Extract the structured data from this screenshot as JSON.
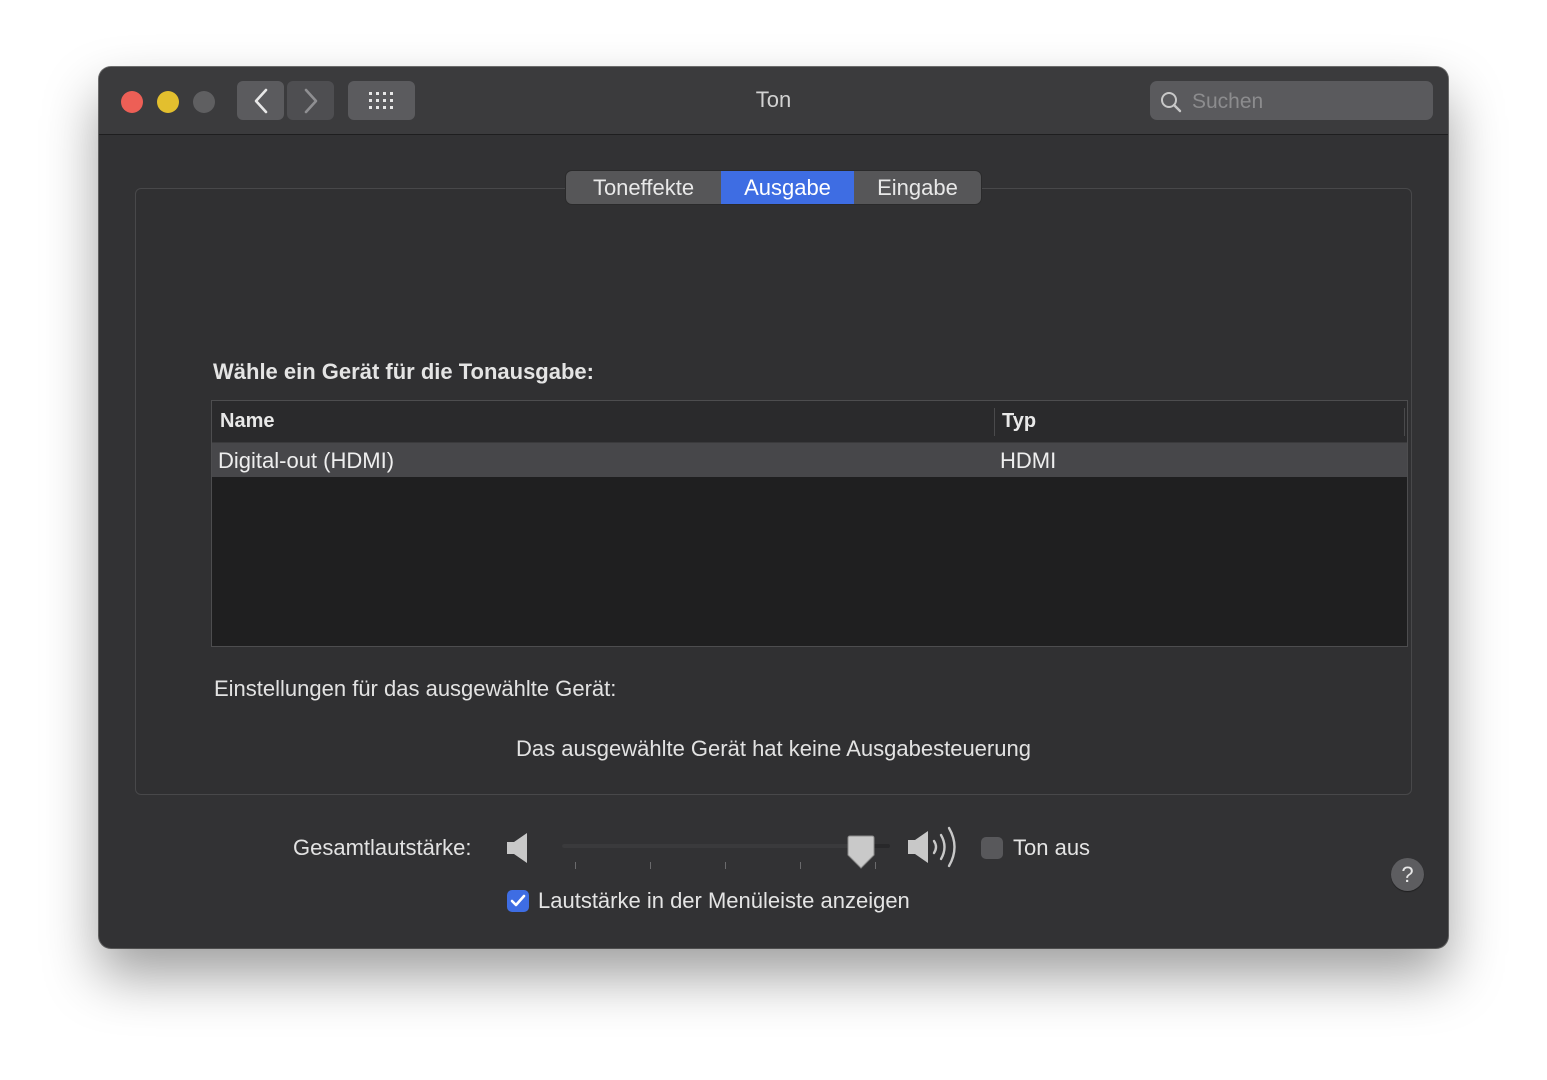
{
  "window": {
    "title": "Ton",
    "search_placeholder": "Suchen"
  },
  "tabs": [
    {
      "label": "Toneffekte",
      "selected": false
    },
    {
      "label": "Ausgabe",
      "selected": true
    },
    {
      "label": "Eingabe",
      "selected": false
    }
  ],
  "output": {
    "heading": "Wähle ein Gerät für die Tonausgabe:",
    "columns": {
      "name": "Name",
      "type": "Typ"
    },
    "devices": [
      {
        "name": "Digital-out (HDMI)",
        "type": "HDMI",
        "selected": true
      }
    ],
    "settings_label": "Einstellungen für das ausgewählte Gerät:",
    "no_control_message": "Das ausgewählte Gerät hat keine Ausgabesteuerung",
    "help_label": "?"
  },
  "volume": {
    "label": "Gesamtlautstärke:",
    "level_fraction": 0.95,
    "mute_label": "Ton aus",
    "mute_checked": false,
    "show_in_menubar_label": "Lautstärke in der Menüleiste anzeigen",
    "show_in_menubar_checked": true
  },
  "colors": {
    "accent": "#3e6de3",
    "close": "#ed5f56",
    "minimize": "#e3bf2e"
  }
}
